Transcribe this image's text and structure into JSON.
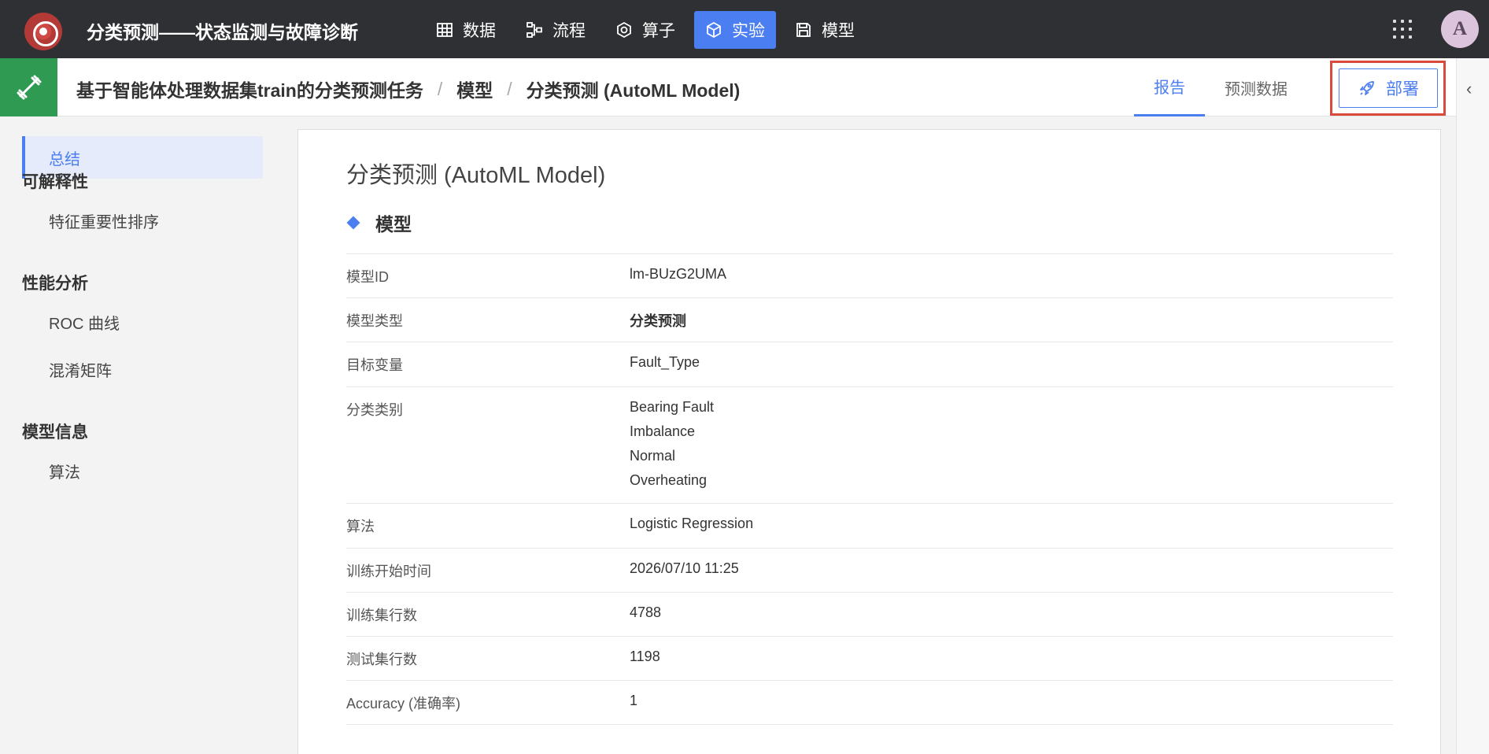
{
  "app": {
    "title": "分类预测——状态监测与故障诊断"
  },
  "nav": {
    "items": [
      {
        "label": "数据",
        "icon": "table-icon"
      },
      {
        "label": "流程",
        "icon": "flow-icon"
      },
      {
        "label": "算子",
        "icon": "operator-icon"
      },
      {
        "label": "实验",
        "icon": "cube-icon",
        "active": true
      },
      {
        "label": "模型",
        "icon": "save-icon"
      }
    ]
  },
  "user": {
    "avatar_letter": "A"
  },
  "breadcrumb": {
    "task": "基于智能体处理数据集train的分类预测任务",
    "section": "模型",
    "current": "分类预测 (AutoML Model)"
  },
  "tabs": [
    {
      "label": "报告",
      "active": true
    },
    {
      "label": "预测数据",
      "active": false
    }
  ],
  "deploy": {
    "label": "部署"
  },
  "sidebar": {
    "summary": "总结",
    "groups": [
      {
        "title": "可解释性",
        "items": [
          "特征重要性排序"
        ]
      },
      {
        "title": "性能分析",
        "items": [
          "ROC 曲线",
          "混淆矩阵"
        ]
      },
      {
        "title": "模型信息",
        "items": [
          "算法"
        ]
      }
    ]
  },
  "main": {
    "title": "分类预测 (AutoML Model)",
    "section_title": "模型",
    "rows": [
      {
        "key": "模型ID",
        "value": "lm-BUzG2UMA"
      },
      {
        "key": "模型类型",
        "value": "分类预测"
      },
      {
        "key": "目标变量",
        "value": "Fault_Type"
      },
      {
        "key": "分类类别",
        "values": [
          "Bearing Fault",
          "Imbalance",
          "Normal",
          "Overheating"
        ]
      },
      {
        "key": "算法",
        "value": "Logistic Regression"
      },
      {
        "key": "训练开始时间",
        "value": "2026/07/10 11:25"
      },
      {
        "key": "训练集行数",
        "value": "4788"
      },
      {
        "key": "测试集行数",
        "value": "1198"
      },
      {
        "key": "Accuracy (准确率)",
        "value": "1"
      }
    ]
  },
  "colors": {
    "accent": "#4b7ef0",
    "topbar": "#2f3033",
    "highlight_box": "#d94a3c",
    "task_icon_bg": "#2f9a52"
  }
}
